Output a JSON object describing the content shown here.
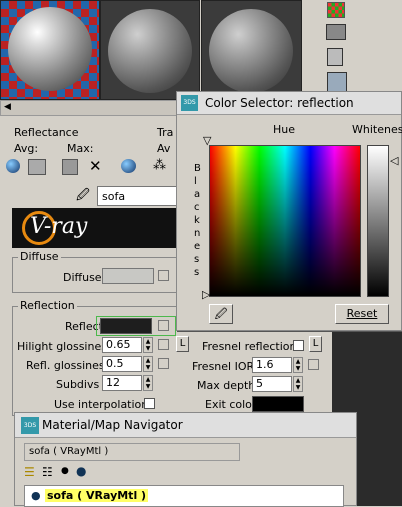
{
  "material_editor": {
    "slot_name": "sofa",
    "reflectance_label": "Reflectance",
    "avg_label": "Avg:",
    "max_label": "Max:",
    "trans_label_partial": "Tra",
    "trans_avg_partial": "Av",
    "vray_logo_text": "V-ray",
    "diffuse_group": "Diffuse",
    "diffuse_label": "Diffuse",
    "reflection_group": "Reflection",
    "reflect_label": "Reflect",
    "hilight_glossiness_label": "Hilight glossiness",
    "hilight_glossiness_value": "0.65",
    "hilight_lock": "L",
    "refl_glossiness_label": "Refl. glossiness",
    "refl_glossiness_value": "0.5",
    "subdivs_label": "Subdivs",
    "subdivs_value": "12",
    "use_interpolation_label": "Use interpolation",
    "fresnel_reflections_label": "Fresnel reflections",
    "fresnel_lock": "L",
    "fresnel_ior_label": "Fresnel IOR",
    "fresnel_ior_value": "1.6",
    "max_depth_label": "Max depth",
    "max_depth_value": "5",
    "exit_color_label": "Exit color"
  },
  "color_selector": {
    "app_badge": "3DS",
    "title": "Color Selector: reflection",
    "hue_label": "Hue",
    "whiteness_label": "Whiteness",
    "blackness_label": "Blackness",
    "reset_label": "Reset"
  },
  "navigator": {
    "app_badge": "3DS",
    "title": "Material/Map Navigator",
    "path_field": "sofa  ( VRayMtl )",
    "tree_item": "sofa  ( VRayMtl )"
  },
  "colors": {
    "reflect_swatch": "#1e1e1e",
    "diffuse_swatch": "#c8c8c4",
    "exit_swatch": "#000000",
    "selection_highlight": "#ffff66"
  }
}
